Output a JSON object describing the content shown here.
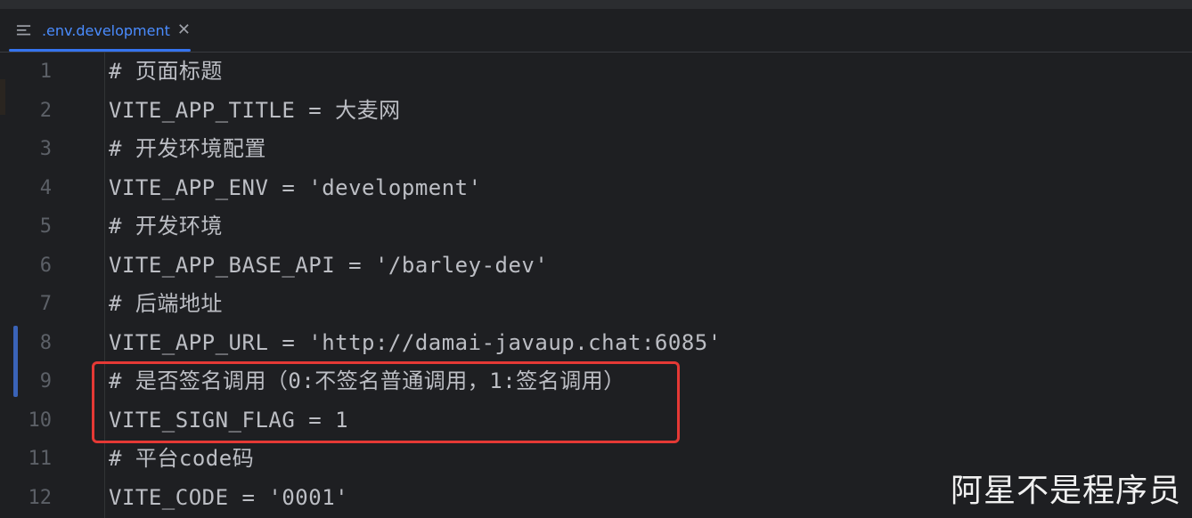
{
  "tab": {
    "label": ".env.development",
    "close_glyph": "✕",
    "icon": "file-lines-icon"
  },
  "lines": [
    {
      "n": "1",
      "text": "# 页面标题"
    },
    {
      "n": "2",
      "text": "VITE_APP_TITLE = 大麦网"
    },
    {
      "n": "3",
      "text": "# 开发环境配置"
    },
    {
      "n": "4",
      "text": "VITE_APP_ENV = 'development'"
    },
    {
      "n": "5",
      "text": "# 开发环境"
    },
    {
      "n": "6",
      "text": "VITE_APP_BASE_API = '/barley-dev'"
    },
    {
      "n": "7",
      "text": "# 后端地址"
    },
    {
      "n": "8",
      "text": "VITE_APP_URL = 'http://damai-javaup.chat:6085'"
    },
    {
      "n": "9",
      "text": "# 是否签名调用（0:不签名普通调用，1:签名调用）"
    },
    {
      "n": "10",
      "text": "VITE_SIGN_FLAG = 1"
    },
    {
      "n": "11",
      "text": "# 平台code码"
    },
    {
      "n": "12",
      "text": "VITE_CODE = '0001'"
    }
  ],
  "watermark": "阿星不是程序员",
  "colors": {
    "accent": "#3574f0",
    "highlight": "#e53935",
    "text": "#bcbec4",
    "line_number": "#5c6067"
  }
}
